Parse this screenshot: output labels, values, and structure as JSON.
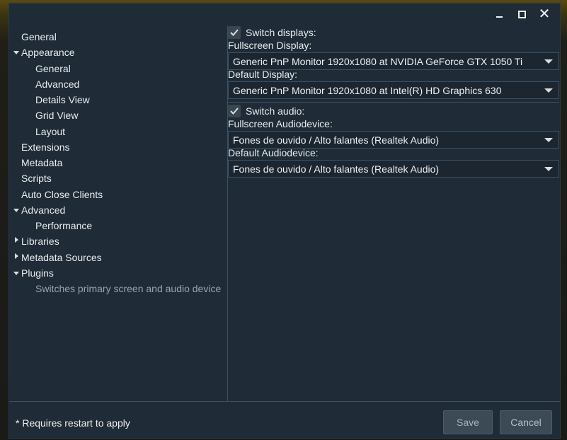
{
  "window": {
    "controls": {
      "minimize_icon": "minimize-icon",
      "maximize_icon": "maximize-icon",
      "close_icon": "close-icon",
      "close_glyph": "✕"
    }
  },
  "sidebar": {
    "items": [
      {
        "label": "General"
      },
      {
        "label": "Appearance"
      },
      {
        "label": "General"
      },
      {
        "label": "Advanced"
      },
      {
        "label": "Details View"
      },
      {
        "label": "Grid View"
      },
      {
        "label": "Layout"
      },
      {
        "label": "Extensions"
      },
      {
        "label": "Metadata"
      },
      {
        "label": "Scripts"
      },
      {
        "label": "Auto Close Clients"
      },
      {
        "label": "Advanced"
      },
      {
        "label": "Performance"
      },
      {
        "label": "Libraries"
      },
      {
        "label": "Metadata Sources"
      },
      {
        "label": "Plugins"
      },
      {
        "label": "Switches primary screen and audio device"
      }
    ]
  },
  "content": {
    "switch_displays": {
      "label": "Switch displays:",
      "checked": true
    },
    "fullscreen_display": {
      "label": "Fullscreen Display:",
      "value": "Generic PnP Monitor 1920x1080 at NVIDIA GeForce GTX 1050 Ti"
    },
    "default_display": {
      "label": "Default Display:",
      "value": "Generic PnP Monitor 1920x1080 at Intel(R) HD Graphics 630"
    },
    "switch_audio": {
      "label": "Switch audio:",
      "checked": true
    },
    "fullscreen_audio": {
      "label": "Fullscreen Audiodevice:",
      "value": "Fones de ouvido / Alto falantes (Realtek Audio)"
    },
    "default_audio": {
      "label": "Default Audiodevice:",
      "value": "Fones de ouvido / Alto falantes (Realtek Audio)"
    }
  },
  "footer": {
    "note": "* Requires restart to apply",
    "save_label": "Save",
    "cancel_label": "Cancel"
  },
  "colors": {
    "window_bg": "#1f2b36",
    "border": "#3b5263",
    "button_bg": "#3c4a55"
  }
}
